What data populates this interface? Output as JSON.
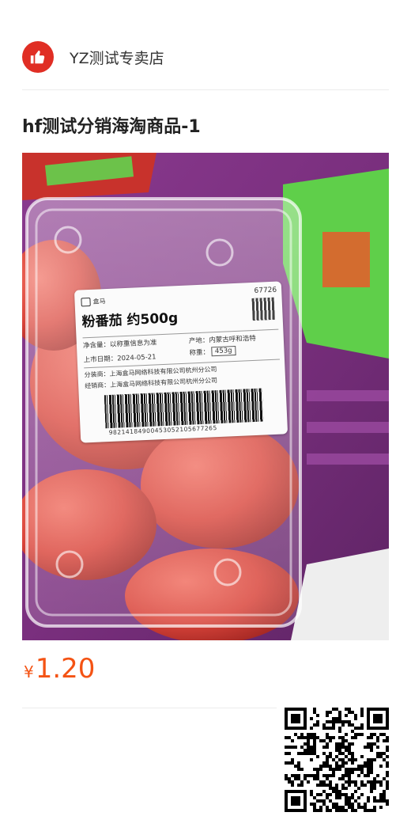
{
  "store": {
    "name": "YZ测试专卖店"
  },
  "product": {
    "title": "hf测试分销海淘商品-1",
    "price_currency": "¥",
    "price_value": "1.20"
  },
  "label": {
    "brand": "盒马",
    "name": "粉番茄 约500g",
    "code": "67726",
    "net_content": "净含量：以称重信息为准",
    "origin": "产地：内蒙古呼和浩特",
    "date": "上市日期：2024-05-21",
    "weight_label": "称重：",
    "weight_value": "453g",
    "packer": "分装商：上海盒马网络科技有限公司杭州分公司",
    "distributor": "经销商：上海盒马网络科技有限公司杭州分公司",
    "barcode_number": "98214184900453052105677265"
  },
  "colors": {
    "price": "#f45314",
    "logo": "#e02e24"
  }
}
